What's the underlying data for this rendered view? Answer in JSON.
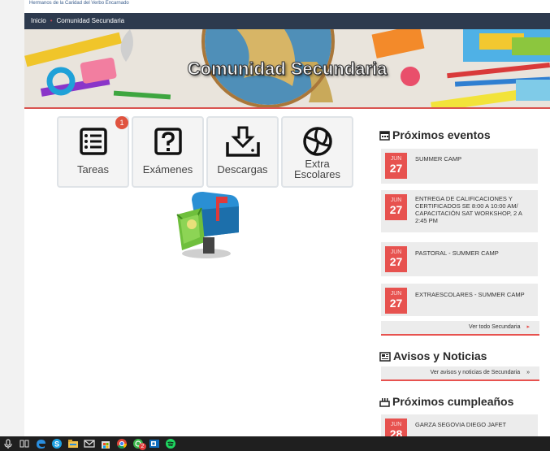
{
  "top_note": "Hermanos de la Caridad del Verbo Encarnado",
  "breadcrumb": {
    "home": "Inicio",
    "separator": "•",
    "current": "Comunidad Secundaria"
  },
  "banner": {
    "title": "Comunidad Secundaria"
  },
  "tiles": [
    {
      "label": "Tareas",
      "icon": "list-icon",
      "badge": "1"
    },
    {
      "label": "Exámenes",
      "icon": "question-icon"
    },
    {
      "label": "Descargas",
      "icon": "download-icon"
    },
    {
      "label_line1": "Extra",
      "label_line2": "Escolares",
      "icon": "volleyball-icon"
    }
  ],
  "events": {
    "title": "Próximos eventos",
    "items": [
      {
        "month": "JUN",
        "day": "27",
        "text": "SUMMER CAMP"
      },
      {
        "month": "JUN",
        "day": "27",
        "text": "ENTREGA DE CALIFICACIONES Y CERTIFICADOS SE 8:00 A 10:00 AM/ CAPACITACIÓN SAT WORKSHOP, 2 A 2:45 PM"
      },
      {
        "month": "JUN",
        "day": "27",
        "text": "PASTORAL - SUMMER CAMP"
      },
      {
        "month": "JUN",
        "day": "27",
        "text": "EXTRAESCOLARES - SUMMER CAMP"
      }
    ],
    "more": "Ver todo Secundaria",
    "more_arrow": "▸"
  },
  "news": {
    "title": "Avisos y Noticias",
    "more": "Ver avisos y noticias de Secundaria",
    "more_arrow": "»"
  },
  "birthdays": {
    "title": "Próximos cumpleaños",
    "items": [
      {
        "month": "JUN",
        "day": "28",
        "text": "GARZA SEGOVIA DIEGO JAFET"
      }
    ]
  },
  "taskbar": {
    "icons": [
      "microphone-icon",
      "task-view-icon",
      "edge-icon",
      "skype-icon",
      "file-explorer-icon",
      "mail-icon",
      "store-icon",
      "chrome-icon",
      "whatsapp-icon",
      "outlook-icon",
      "spotify-icon"
    ],
    "whatsapp_badge": "2"
  },
  "colors": {
    "accent": "#e7524f",
    "nav": "#2d3a4e"
  }
}
